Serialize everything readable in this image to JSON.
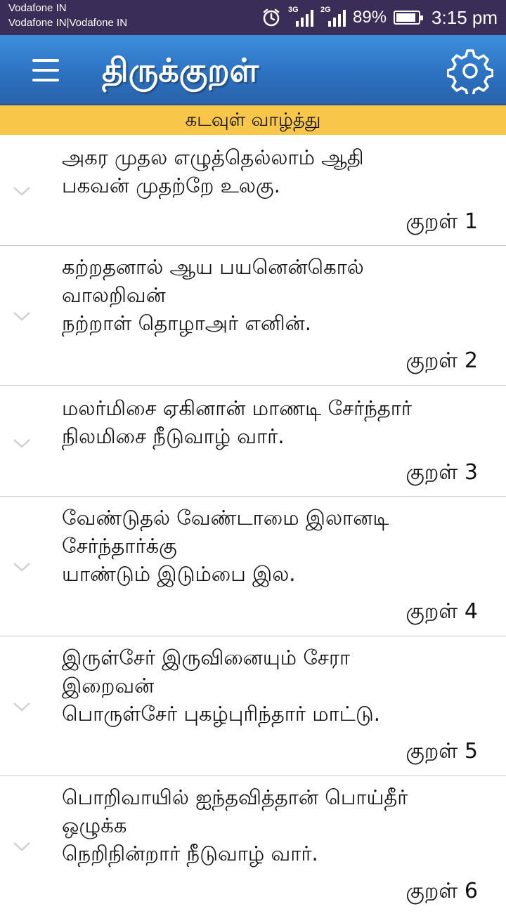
{
  "status_bar": {
    "carrier_line1": "Vodafone IN",
    "carrier_line2": "Vodafone IN|Vodafone IN",
    "network1": "3G",
    "network2": "2G",
    "battery_percent_text": "89%",
    "battery_level": 0.89,
    "time": "3:15 pm",
    "icons": [
      "alarm-icon",
      "signal-icon",
      "signal-icon",
      "battery-icon"
    ]
  },
  "app_bar": {
    "title": "திருக்குறள்",
    "menu_icon": "menu-icon",
    "settings_icon": "gear-icon",
    "colors": {
      "top": "#3d8fdc",
      "bottom": "#2a62a8"
    }
  },
  "chapter": {
    "title": "கடவுள் வாழ்த்து",
    "color": "#f8c74a"
  },
  "kurals": [
    {
      "text": "அகர முதல எழுத்தெல்லாம் ஆதி\nபகவன் முதற்றே உலகு.",
      "label": "குறள் 1"
    },
    {
      "text": "கற்றதனால் ஆய பயனென்கொல்\nவாலறிவன்\nநற்றாள் தொழாஅர் எனின்.",
      "label": "குறள் 2"
    },
    {
      "text": "மலர்மிசை ஏகினான் மாணடி சேர்ந்தார்\nநிலமிசை நீடுவாழ் வார்.",
      "label": "குறள் 3"
    },
    {
      "text": "வேண்டுதல் வேண்டாமை இலானடி\nசேர்ந்தார்க்கு\nயாண்டும் இடும்பை இல.",
      "label": "குறள் 4"
    },
    {
      "text": "இருள்சேர் இருவினையும் சேரா\nஇறைவன்\nபொருள்சேர் புகழ்புரிந்தார் மாட்டு.",
      "label": "குறள் 5"
    },
    {
      "text": "பொறிவாயில் ஐந்தவித்தான் பொய்தீர்\nஒழுக்க\nநெறிநின்றார் நீடுவாழ் வார்.",
      "label": "குறள் 6"
    }
  ]
}
